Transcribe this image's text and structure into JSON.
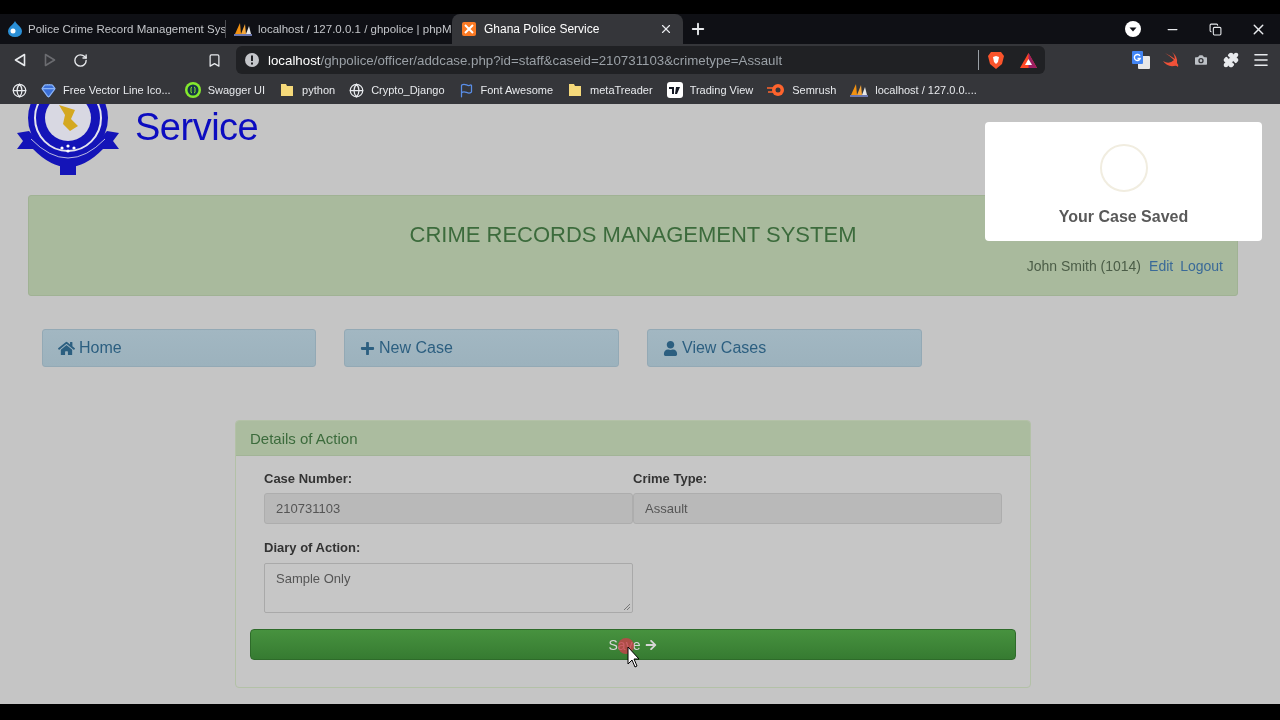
{
  "browser": {
    "tabs": [
      {
        "title": "Police Crime Record Management Sys",
        "selected": false
      },
      {
        "title": "localhost / 127.0.0.1 / ghpolice | phpM",
        "selected": false
      },
      {
        "title": "Ghana Police Service",
        "selected": true
      }
    ],
    "toolbar": {
      "forward_disabled": true,
      "url_host": "localhost",
      "url_path": "/ghpolice/officer/addcase.php?id=staff&caseid=210731103&crimetype=Assault"
    },
    "bookmarks": [
      "Free Vector Line Ico...",
      "Swagger UI",
      "python",
      "Crypto_Django",
      "Font Awesome",
      "metaTreader",
      "Trading View",
      "Semrush",
      "localhost / 127.0.0...."
    ]
  },
  "page": {
    "header": {
      "title": "Service"
    },
    "banner": {
      "title": "CRIME RECORDS MANAGEMENT SYSTEM",
      "user": "John Smith (1014)",
      "links": [
        "Edit",
        "Logout"
      ]
    },
    "nav": [
      "Home",
      "New Case",
      "View Cases"
    ],
    "panel": {
      "title": "Details of Action",
      "fields": [
        {
          "kind": "input",
          "label": "Case Number:",
          "value": "210731103",
          "disabled": true
        },
        {
          "kind": "input",
          "label": "Crime Type:",
          "value": "Assault",
          "disabled": true
        },
        {
          "kind": "textarea",
          "label": "Diary of Action:",
          "value": "Sample Only",
          "disabled": false
        }
      ],
      "submit": "Save"
    },
    "dialog": {
      "message": "Your Case Saved"
    }
  }
}
